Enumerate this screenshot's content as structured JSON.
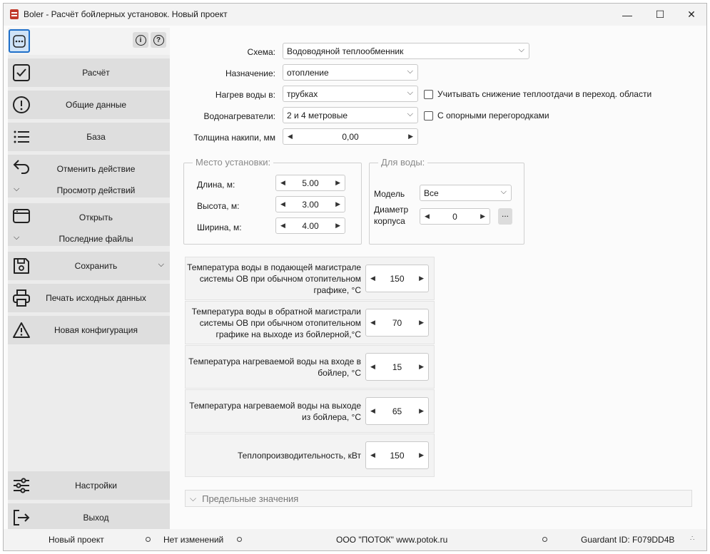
{
  "window": {
    "title": "Boler - Расчёт бойлерных установок. Новый проект"
  },
  "controls": {
    "minimize": "—",
    "maximize": "☐",
    "close": "✕"
  },
  "sidebar": {
    "items": [
      {
        "label": "Расчёт",
        "icon": "check-square-icon"
      },
      {
        "label": "Общие данные",
        "icon": "exclamation-circle-icon"
      },
      {
        "label": "База",
        "icon": "list-icon"
      },
      {
        "label": "Отменить действие",
        "icon": "undo-arrow-icon"
      },
      {
        "label": "Просмотр действий",
        "icon": "chevron-down-icon"
      },
      {
        "label": "Открыть",
        "icon": "folder-window-icon"
      },
      {
        "label": "Последние файлы",
        "icon": "chevron-down-icon"
      },
      {
        "label": "Сохранить",
        "icon": "floppy-icon"
      },
      {
        "label": "Печать исходных данных",
        "icon": "printer-icon"
      },
      {
        "label": "Новая конфигурация",
        "icon": "warning-triangle-icon"
      },
      {
        "label": "Настройки",
        "icon": "sliders-icon"
      },
      {
        "label": "Выход",
        "icon": "exit-icon"
      }
    ]
  },
  "form": {
    "scheme_label": "Схема:",
    "scheme_value": "Водоводяной теплообменник",
    "purpose_label": "Назначение:",
    "purpose_value": "отопление",
    "heating_label": "Нагрев воды в:",
    "heating_value": "трубках",
    "transition_check": "Учитывать снижение теплоотдачи в переход. области",
    "heaters_label": "Водонагреватели:",
    "heaters_value": "2 и 4 метровые",
    "partitions_check": "С опорными перегородками",
    "scale_label": "Толщина накипи, мм",
    "scale_value": "0,00"
  },
  "install": {
    "title": "Место установки:",
    "length_label": "Длина, м:",
    "length_value": "5.00",
    "height_label": "Высота, м:",
    "height_value": "3.00",
    "width_label": "Ширина, м:",
    "width_value": "4.00"
  },
  "water": {
    "title": "Для воды:",
    "model_label": "Модель",
    "model_value": "Все",
    "diameter_label_1": "Диаметр",
    "diameter_label_2": "корпуса",
    "diameter_value": "0",
    "more_button": "..."
  },
  "temps": [
    {
      "label": "Температура воды в подающей магистрале системы ОВ при обычном отопительном графике, °С",
      "value": "150"
    },
    {
      "label": "Температура воды в обратной магистрали системы ОВ при обычном отопительном графике на выходе из бойлерной,°С",
      "value": "70"
    },
    {
      "label": "Температура нагреваемой воды на входе в бойлер, °С",
      "value": "15"
    },
    {
      "label": "Температура нагреваемой воды на выходе из бойлера, °С",
      "value": "65"
    },
    {
      "label": "Теплопроизводительность, кВт",
      "value": "150"
    }
  ],
  "limits": {
    "label": "Предельные значения"
  },
  "status": {
    "project": "Новый проект",
    "changes": "Нет изменений",
    "company": "ООО \"ПОТОК\" www.potok.ru",
    "guardant": "Guardant ID: F079DD4B"
  },
  "colors": {
    "accent": "#1e6fc9",
    "sidebar_item_bg": "#dedede",
    "menu_active_bg": "#cfe3f7"
  }
}
